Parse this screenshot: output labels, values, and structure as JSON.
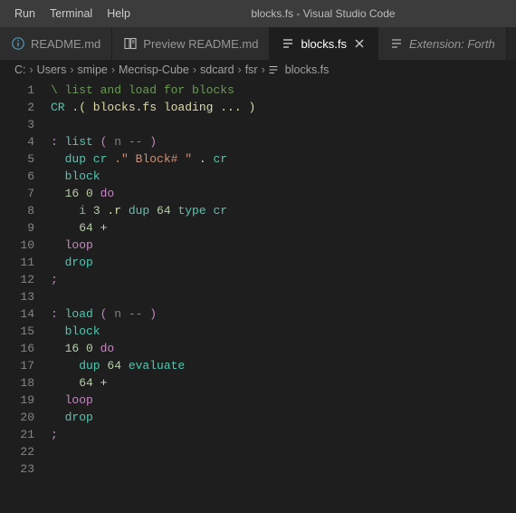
{
  "menu": {
    "run": "Run",
    "terminal": "Terminal",
    "help": "Help"
  },
  "window_title": "blocks.fs - Visual Studio Code",
  "tabs": [
    {
      "label": "README.md"
    },
    {
      "label": "Preview README.md"
    },
    {
      "label": "blocks.fs"
    },
    {
      "label": "Extension: Forth"
    }
  ],
  "breadcrumbs": [
    "C:",
    "Users",
    "smipe",
    "Mecrisp-Cube",
    "sdcard",
    "fsr",
    "blocks.fs"
  ],
  "code": {
    "lines": [
      [
        {
          "t": "\\ list and load for blocks",
          "c": "tok-comment"
        }
      ],
      [
        {
          "t": "CR ",
          "c": "tok-def"
        },
        {
          "t": ".( blocks.fs loading ... )",
          "c": "tok-func"
        }
      ],
      [],
      [
        {
          "t": ": ",
          "c": "tok-define"
        },
        {
          "t": "list ",
          "c": "tok-def"
        },
        {
          "t": "( ",
          "c": "tok-define"
        },
        {
          "t": "n -- ",
          "c": "tok-dim"
        },
        {
          "t": ")",
          "c": "tok-define"
        }
      ],
      [
        {
          "t": "  dup cr ",
          "c": "tok-def"
        },
        {
          "t": ".\" Block# \"",
          "c": "tok-string"
        },
        {
          "t": " . ",
          "c": "tok-word"
        },
        {
          "t": "cr",
          "c": "tok-def"
        }
      ],
      [
        {
          "t": "  block",
          "c": "tok-def"
        }
      ],
      [
        {
          "t": "  ",
          "c": ""
        },
        {
          "t": "16 0 ",
          "c": "tok-number"
        },
        {
          "t": "do",
          "c": "tok-define"
        }
      ],
      [
        {
          "t": "    i ",
          "c": "tok-def"
        },
        {
          "t": "3 ",
          "c": "tok-number"
        },
        {
          "t": ".r ",
          "c": "tok-func"
        },
        {
          "t": "dup ",
          "c": "tok-def"
        },
        {
          "t": "64 ",
          "c": "tok-number"
        },
        {
          "t": "type cr",
          "c": "tok-def"
        }
      ],
      [
        {
          "t": "    ",
          "c": ""
        },
        {
          "t": "64 ",
          "c": "tok-number"
        },
        {
          "t": "+",
          "c": "tok-word"
        }
      ],
      [
        {
          "t": "  ",
          "c": ""
        },
        {
          "t": "loop",
          "c": "tok-define"
        }
      ],
      [
        {
          "t": "  drop",
          "c": "tok-def"
        }
      ],
      [
        {
          "t": ";",
          "c": "tok-define"
        }
      ],
      [],
      [
        {
          "t": ": ",
          "c": "tok-define"
        },
        {
          "t": "load ",
          "c": "tok-def"
        },
        {
          "t": "( ",
          "c": "tok-define"
        },
        {
          "t": "n -- ",
          "c": "tok-dim"
        },
        {
          "t": ")",
          "c": "tok-define"
        }
      ],
      [
        {
          "t": "  block",
          "c": "tok-def"
        }
      ],
      [
        {
          "t": "  ",
          "c": ""
        },
        {
          "t": "16 0 ",
          "c": "tok-number"
        },
        {
          "t": "do",
          "c": "tok-define"
        }
      ],
      [
        {
          "t": "    dup ",
          "c": "tok-def"
        },
        {
          "t": "64 ",
          "c": "tok-number"
        },
        {
          "t": "evaluate",
          "c": "tok-def"
        }
      ],
      [
        {
          "t": "    ",
          "c": ""
        },
        {
          "t": "64 ",
          "c": "tok-number"
        },
        {
          "t": "+",
          "c": "tok-word"
        }
      ],
      [
        {
          "t": "  ",
          "c": ""
        },
        {
          "t": "loop",
          "c": "tok-define"
        }
      ],
      [
        {
          "t": "  drop",
          "c": "tok-def"
        }
      ],
      [
        {
          "t": ";",
          "c": "tok-define"
        }
      ],
      [],
      []
    ]
  }
}
